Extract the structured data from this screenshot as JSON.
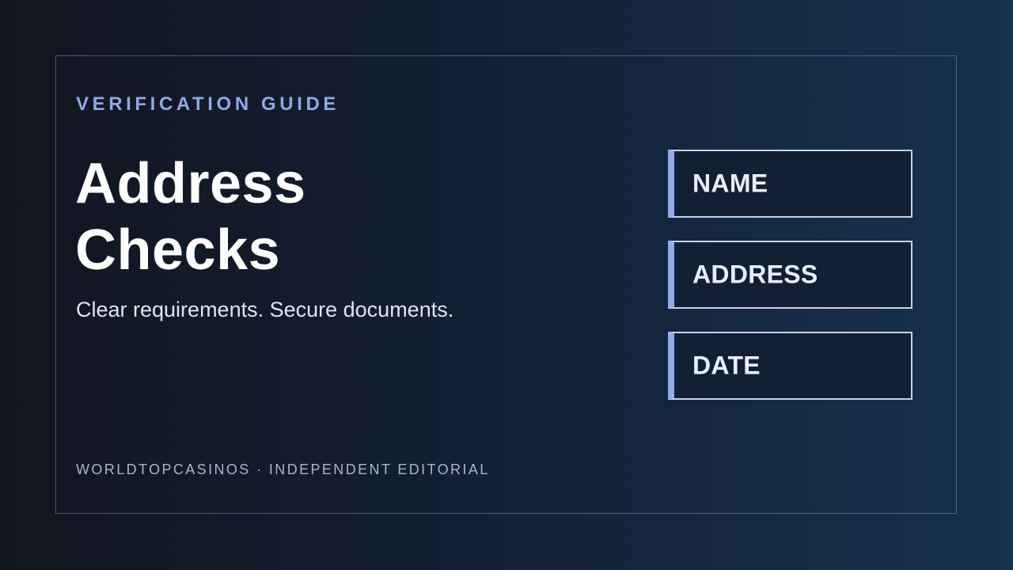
{
  "card": {
    "eyebrow": "VERIFICATION GUIDE",
    "headline_line1": "Address",
    "headline_line2": "Checks",
    "subtitle": "Clear requirements. Secure documents.",
    "footer": "WORLDTOPCASINOS · INDEPENDENT EDITORIAL"
  },
  "fields": [
    {
      "label": "NAME"
    },
    {
      "label": "ADDRESS"
    },
    {
      "label": "DATE"
    }
  ],
  "colors": {
    "background_start": "#11151f",
    "background_end": "#17314f",
    "accent": "#8fa9e6",
    "field_border": "#c5d1e6",
    "field_fill": "#131f33"
  }
}
